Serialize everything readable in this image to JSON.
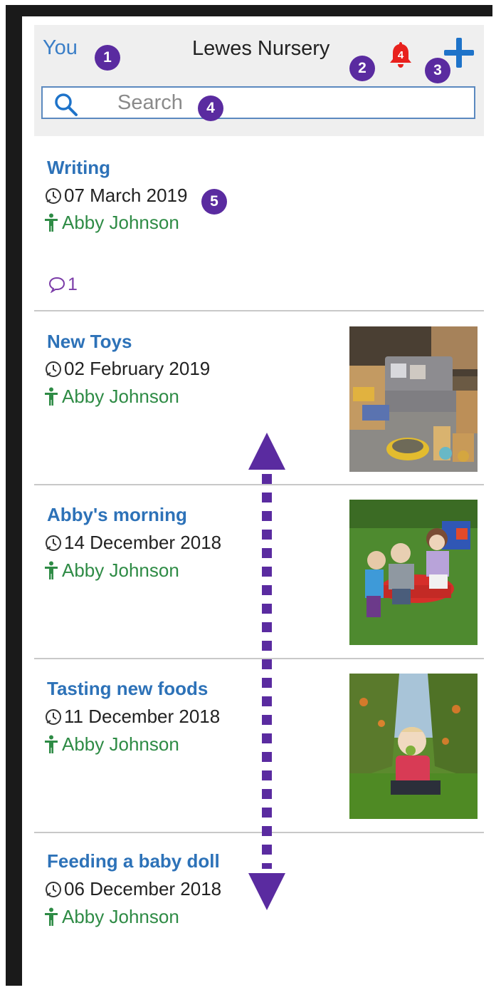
{
  "header": {
    "you_label": "You",
    "title": "Lewes Nursery",
    "notification_count": "4"
  },
  "search": {
    "placeholder": "Search"
  },
  "markers": [
    "1",
    "2",
    "3",
    "4",
    "5"
  ],
  "items": [
    {
      "title": "Writing",
      "date": "07 March 2019",
      "child": "Abby Johnson",
      "comment_count": "1"
    },
    {
      "title": "New Toys",
      "date": "02 February 2019",
      "child": "Abby Johnson"
    },
    {
      "title": "Abby's morning",
      "date": "14 December 2018",
      "child": "Abby Johnson"
    },
    {
      "title": "Tasting new foods",
      "date": "11 December 2018",
      "child": "Abby Johnson"
    },
    {
      "title": "Feeding a baby doll",
      "date": "06 December 2018",
      "child": "Abby Johnson"
    }
  ],
  "colors": {
    "accent_blue": "#2d72b8",
    "child_green": "#2e8b45",
    "marker_purple": "#5a2ba0",
    "notification_red": "#e8211d"
  }
}
